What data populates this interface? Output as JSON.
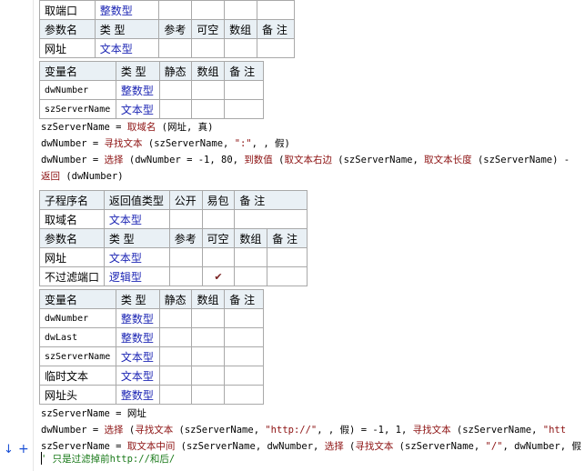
{
  "top_table_1": {
    "rows": [
      [
        "取端口",
        "整数型",
        "",
        "",
        "",
        ""
      ],
      [
        "参数名",
        "类 型",
        "参考",
        "可空",
        "数组",
        "备 注"
      ],
      [
        "网址",
        "文本型",
        "",
        "",
        "",
        ""
      ]
    ]
  },
  "var_table_1": {
    "headers": [
      "变量名",
      "类 型",
      "静态",
      "数组",
      "备 注"
    ],
    "rows": [
      [
        "dwNumber",
        "整数型",
        "",
        "",
        ""
      ],
      [
        "szServerName",
        "文本型",
        "",
        "",
        ""
      ]
    ]
  },
  "code_1": {
    "line1_a": "szServerName = ",
    "line1_b": "取域名",
    "line1_c": " (网址, 真)",
    "line2_a": "dwNumber = ",
    "line2_b": "寻找文本",
    "line2_c": " (szServerName, ",
    "line2_d": "\":\"",
    "line2_e": ", , 假)",
    "line3_a": "dwNumber = ",
    "line3_b": "选择",
    "line3_c": " (dwNumber = -1, 80, ",
    "line3_d": "到数值",
    "line3_e": " (",
    "line3_f": "取文本右边",
    "line3_g": " (szServerName, ",
    "line3_h": "取文本长度",
    "line3_i": " (szServerName) -",
    "line4_a": "返回",
    "line4_b": " (dwNumber)"
  },
  "sub_table_2": {
    "rows": [
      [
        "子程序名",
        "返回值类型",
        "公开",
        "易包",
        "备 注",
        ""
      ],
      [
        "取域名",
        "文本型",
        "",
        "",
        "",
        ""
      ],
      [
        "参数名",
        "类 型",
        "参考",
        "可空",
        "数组",
        "备 注"
      ],
      [
        "网址",
        "文本型",
        "",
        "",
        "",
        ""
      ],
      [
        "不过滤端口",
        "逻辑型",
        "",
        "✔",
        "",
        ""
      ]
    ]
  },
  "var_table_2": {
    "headers": [
      "变量名",
      "类 型",
      "静态",
      "数组",
      "备 注"
    ],
    "rows": [
      [
        "dwNumber",
        "整数型",
        "",
        "",
        ""
      ],
      [
        "dwLast",
        "整数型",
        "",
        "",
        ""
      ],
      [
        "szServerName",
        "文本型",
        "",
        "",
        ""
      ],
      [
        "临时文本",
        "文本型",
        "",
        "",
        ""
      ],
      [
        "网址头",
        "整数型",
        "",
        "",
        ""
      ]
    ]
  },
  "code_2": {
    "line1": "szServerName = 网址",
    "line2_a": "dwNumber = ",
    "line2_b": "选择",
    "line2_c": " (",
    "line2_d": "寻找文本",
    "line2_e": " (szServerName, ",
    "line2_f": "\"http://\"",
    "line2_g": ", , 假) = -1, 1, ",
    "line2_h": "寻找文本",
    "line2_i": " (szServerName, ",
    "line2_j": "\"htt",
    "line3_a": "szServerName = ",
    "line3_b": "取文本中间",
    "line3_c": " (szServerName, dwNumber, ",
    "line3_d": "选择",
    "line3_e": " (",
    "line3_f": "寻找文本",
    "line3_g": " (szServerName, ",
    "line3_h": "\"/\"",
    "line3_i": ", dwNumber, 假",
    "line4": "' 只是过滤掉前http://和后/"
  },
  "gutter": {
    "arrow_icon": "down-arrow-icon",
    "arrow_glyph": "↓",
    "plus_icon": "plus-icon",
    "plus_glyph": "+"
  },
  "colors": {
    "keyword": "#8c1010",
    "type_blue": "#1d26b4",
    "comment": "#1a7a1a",
    "header_bg": "#e9f0f5",
    "grid": "#a9a9a9"
  }
}
